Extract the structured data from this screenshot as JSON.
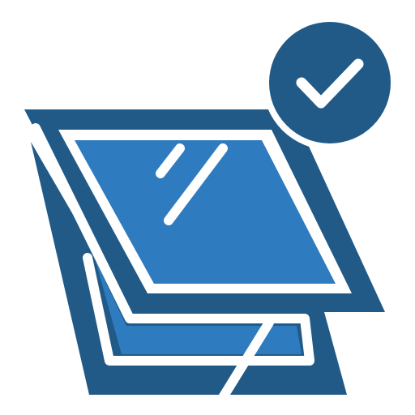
{
  "icon": {
    "name": "window-approved-icon",
    "description_name": "skylight-window-with-checkmark",
    "badge": "checkmark-icon"
  },
  "colors": {
    "background": "#ffffff",
    "dark_blue": "#215a87",
    "light_blue": "#2e7bc0",
    "white": "#ffffff"
  }
}
